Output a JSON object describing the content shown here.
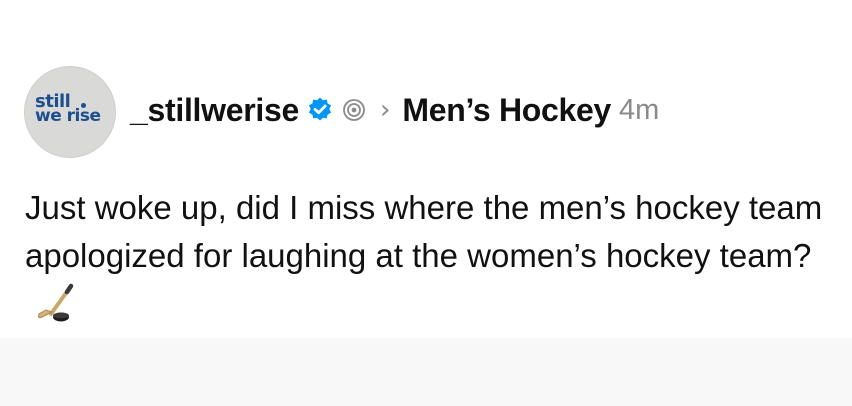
{
  "post": {
    "avatar": {
      "line1": "still",
      "line2": "we rise"
    },
    "username": "_stillwerise",
    "chevron": "›",
    "community": "Men’s Hockey",
    "time": "4m",
    "text": "Just woke up, did I miss where the men’s hockey team apologized for laughing at the women’s hockey team?"
  },
  "icons": {
    "verified": "verified-badge-icon",
    "tag": "threads-tag-icon",
    "emoji": "ice-hockey-stick-emoji"
  },
  "colors": {
    "verified_blue": "#0095f6",
    "text": "#111111",
    "muted": "#8a8a8a",
    "avatar_bg": "#d9d9d7",
    "avatar_text": "#1d4f8f"
  }
}
